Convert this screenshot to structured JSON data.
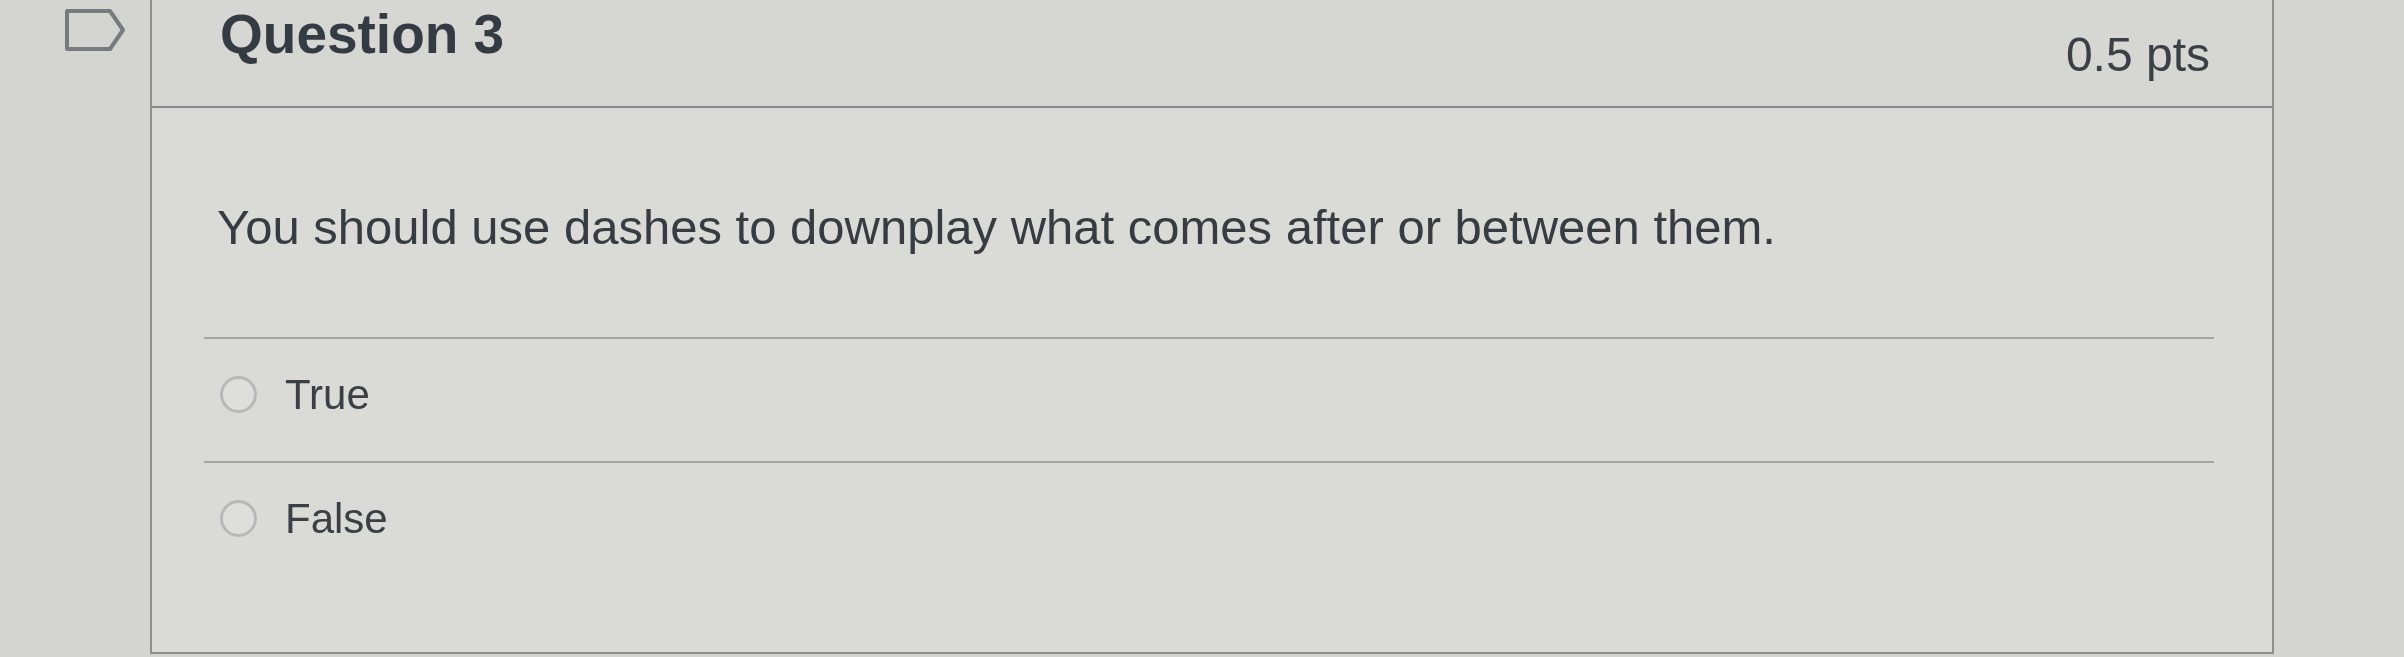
{
  "question": {
    "flagged": false,
    "title": "Question 3",
    "points": "0.5 pts",
    "text": "You should use dashes to downplay what comes after or between them.",
    "answers": [
      {
        "label": "True",
        "selected": false
      },
      {
        "label": "False",
        "selected": false
      }
    ]
  }
}
